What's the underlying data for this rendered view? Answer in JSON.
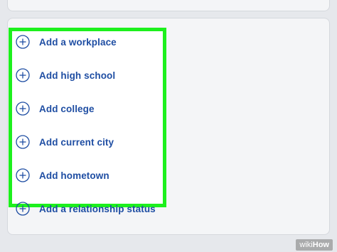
{
  "items": [
    {
      "label": "Add a workplace",
      "icon": "plus-circle-icon"
    },
    {
      "label": "Add high school",
      "icon": "plus-circle-icon"
    },
    {
      "label": "Add college",
      "icon": "plus-circle-icon"
    },
    {
      "label": "Add current city",
      "icon": "plus-circle-icon"
    },
    {
      "label": "Add hometown",
      "icon": "plus-circle-icon"
    },
    {
      "label": "Add a relationship status",
      "icon": "plus-circle-icon"
    }
  ],
  "colors": {
    "link": "#1f4ea3",
    "highlight": "#1df01d",
    "background": "#e6e8ec"
  },
  "watermark": {
    "part1": "wiki",
    "part2": "How"
  }
}
